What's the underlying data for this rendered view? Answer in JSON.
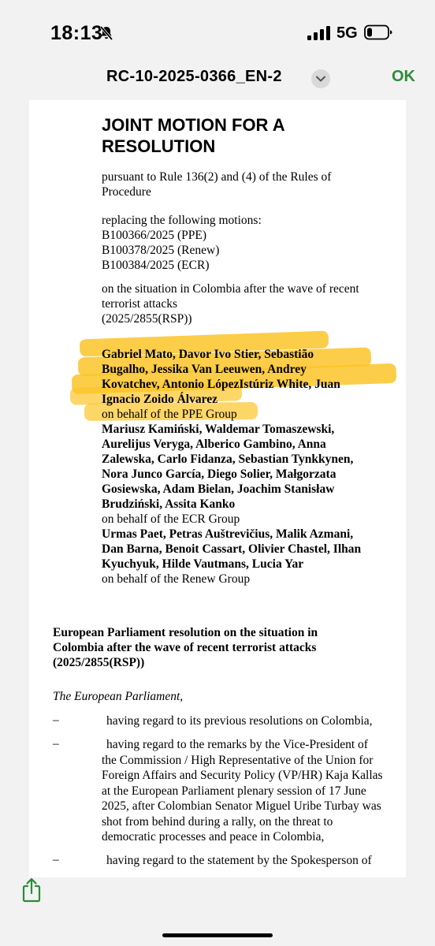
{
  "status_bar": {
    "time": "18:13",
    "network": "5G",
    "mute_icon": "bell-slash-icon",
    "signal_icon": "signal-bars-icon",
    "battery_icon": "battery-icon"
  },
  "nav": {
    "title": "RC-10-2025-0366_EN-2",
    "ok_label": "OK",
    "accent": "#2e8b3a"
  },
  "doc": {
    "heading_lines": [
      "JOINT MOTION FOR A",
      "RESOLUTION"
    ],
    "pursuant_lines": [
      "pursuant to Rule 136(2) and (4) of the Rules of",
      "Procedure"
    ],
    "replacing_lines": [
      "replacing the following motions:",
      "B100366/2025 (PPE)",
      "B100378/2025 (Renew)",
      "B100384/2025 (ECR)"
    ],
    "situation_lines": [
      "on the situation in Colombia after the wave of recent",
      "terrorist attacks",
      "(2025/2855(RSP))"
    ],
    "ppe_names": [
      "Gabriel Mato, Davor Ivo Stier, Sebastião",
      "Bugalho, Jessika Van Leeuwen, Andrey",
      "Kovatchev, Antonio LópezIstúriz White, Juan",
      "Ignacio Zoido Álvarez"
    ],
    "ppe_behalf": "on behalf of the PPE Group",
    "ecr_names": [
      "Mariusz Kamiński, Waldemar Tomaszewski,",
      "Aurelijus Veryga, Alberico Gambino, Anna",
      "Zalewska, Carlo Fidanza, Sebastian Tynkkynen,",
      "Nora Junco García, Diego Solier, Małgorzata",
      "Gosiewska, Adam Bielan, Joachim Stanisław",
      "Brudziński, Assita Kanko"
    ],
    "ecr_behalf": "on behalf of the ECR Group",
    "renew_names": [
      "Urmas Paet, Petras Auštrevičius, Malik Azmani,",
      "Dan Barna, Benoit Cassart, Olivier Chastel, Ilhan",
      "Kyuchyuk, Hilde Vautmans, Lucia Yar"
    ],
    "renew_behalf": "on behalf of the Renew Group",
    "resolution_title_lines": [
      "European Parliament resolution on the situation in",
      "Colombia after the wave of recent terrorist attacks",
      "(2025/2855(RSP))"
    ],
    "the_parliament": "The European Parliament",
    "the_parliament_suffix": ",",
    "dash": "–",
    "items": [
      {
        "lines": [
          "having regard to its previous resolutions on Colombia,"
        ]
      },
      {
        "lines": [
          "having regard to the remarks by the Vice-President of",
          "the Commission / High Representative of the Union for",
          "Foreign Affairs and Security Policy (VP/HR) Kaja Kallas",
          "at the European Parliament plenary session of 17 June",
          "2025, after Colombian Senator Miguel Uribe Turbay was",
          "shot from behind during a rally, on the threat to",
          "democratic processes and peace in Colombia,"
        ]
      },
      {
        "lines": [
          "having regard to the statement by the Spokesperson of"
        ]
      }
    ],
    "highlight_color": "#fcc428"
  },
  "toolbar": {
    "share_icon": "share-icon"
  }
}
